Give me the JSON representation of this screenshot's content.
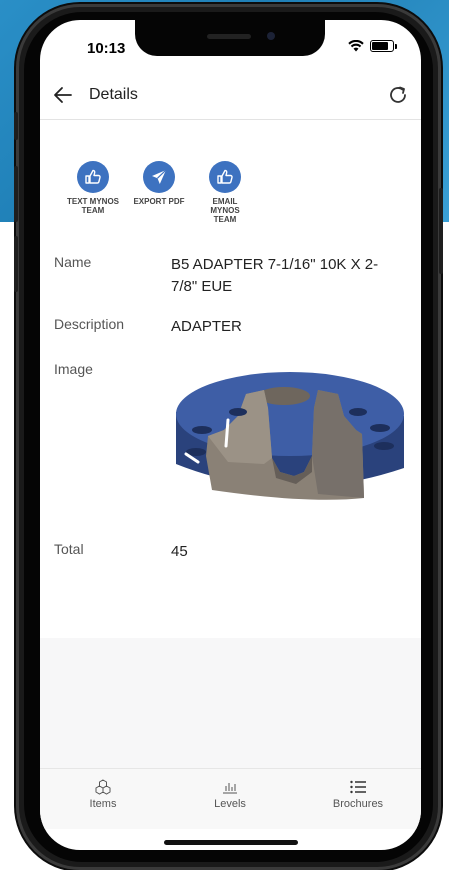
{
  "status": {
    "time": "10:13"
  },
  "header": {
    "title": "Details"
  },
  "actions": [
    {
      "label": "TEXT MYNOS TEAM",
      "icon": "thumbs-up-icon"
    },
    {
      "label": "EXPORT PDF",
      "icon": "send-icon"
    },
    {
      "label": "EMAIL MYNOS TEAM",
      "icon": "thumbs-up-icon"
    }
  ],
  "fields": {
    "name_label": "Name",
    "name_value": "B5 ADAPTER 7-1/16\" 10K X 2-7/8\" EUE",
    "description_label": "Description",
    "description_value": "ADAPTER",
    "image_label": "Image",
    "total_label": "Total",
    "total_value": "45"
  },
  "tabs": [
    {
      "label": "Items",
      "icon": "cubes-icon"
    },
    {
      "label": "Levels",
      "icon": "bar-chart-icon"
    },
    {
      "label": "Brochures",
      "icon": "list-icon"
    }
  ],
  "colors": {
    "accent": "#3d72c0",
    "part_blue": "#2f4a8a",
    "part_metal": "#8a8176"
  }
}
